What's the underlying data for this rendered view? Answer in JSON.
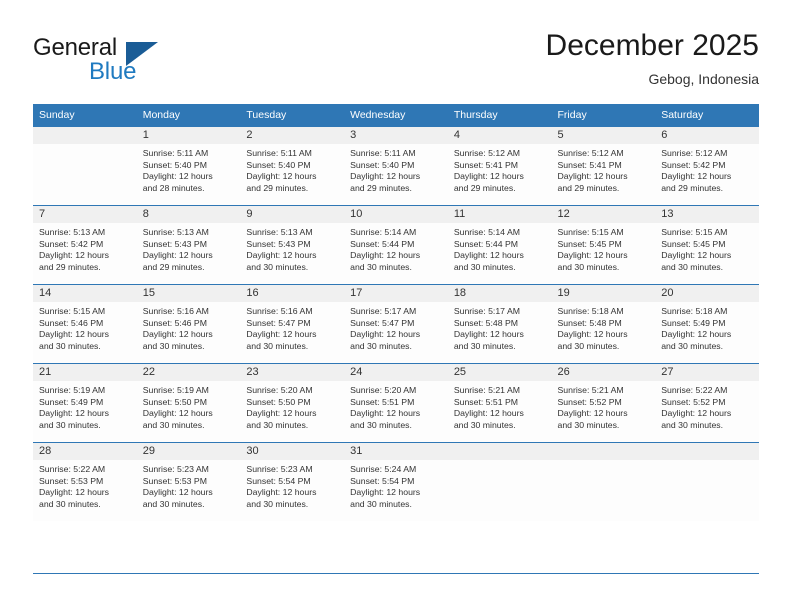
{
  "brand": {
    "name_part1": "General",
    "name_part2": "Blue",
    "triangle_color": "#1a5c96",
    "blue_color": "#1f7ac0"
  },
  "header": {
    "month_title": "December 2025",
    "location": "Gebog, Indonesia"
  },
  "theme": {
    "header_bg": "#2f77b5",
    "daynum_bg": "#f0f0f0",
    "cell_bg": "#fdfdfd",
    "text": "#333333"
  },
  "weekday_headers": [
    "Sunday",
    "Monday",
    "Tuesday",
    "Wednesday",
    "Thursday",
    "Friday",
    "Saturday"
  ],
  "weeks": [
    [
      {
        "day": "",
        "blank": true,
        "sunrise": "",
        "sunset": "",
        "daylight_line1": "",
        "daylight_line2": ""
      },
      {
        "day": "1",
        "sunrise": "Sunrise: 5:11 AM",
        "sunset": "Sunset: 5:40 PM",
        "daylight_line1": "Daylight: 12 hours",
        "daylight_line2": "and 28 minutes."
      },
      {
        "day": "2",
        "sunrise": "Sunrise: 5:11 AM",
        "sunset": "Sunset: 5:40 PM",
        "daylight_line1": "Daylight: 12 hours",
        "daylight_line2": "and 29 minutes."
      },
      {
        "day": "3",
        "sunrise": "Sunrise: 5:11 AM",
        "sunset": "Sunset: 5:40 PM",
        "daylight_line1": "Daylight: 12 hours",
        "daylight_line2": "and 29 minutes."
      },
      {
        "day": "4",
        "sunrise": "Sunrise: 5:12 AM",
        "sunset": "Sunset: 5:41 PM",
        "daylight_line1": "Daylight: 12 hours",
        "daylight_line2": "and 29 minutes."
      },
      {
        "day": "5",
        "sunrise": "Sunrise: 5:12 AM",
        "sunset": "Sunset: 5:41 PM",
        "daylight_line1": "Daylight: 12 hours",
        "daylight_line2": "and 29 minutes."
      },
      {
        "day": "6",
        "sunrise": "Sunrise: 5:12 AM",
        "sunset": "Sunset: 5:42 PM",
        "daylight_line1": "Daylight: 12 hours",
        "daylight_line2": "and 29 minutes."
      }
    ],
    [
      {
        "day": "7",
        "sunrise": "Sunrise: 5:13 AM",
        "sunset": "Sunset: 5:42 PM",
        "daylight_line1": "Daylight: 12 hours",
        "daylight_line2": "and 29 minutes."
      },
      {
        "day": "8",
        "sunrise": "Sunrise: 5:13 AM",
        "sunset": "Sunset: 5:43 PM",
        "daylight_line1": "Daylight: 12 hours",
        "daylight_line2": "and 29 minutes."
      },
      {
        "day": "9",
        "sunrise": "Sunrise: 5:13 AM",
        "sunset": "Sunset: 5:43 PM",
        "daylight_line1": "Daylight: 12 hours",
        "daylight_line2": "and 30 minutes."
      },
      {
        "day": "10",
        "sunrise": "Sunrise: 5:14 AM",
        "sunset": "Sunset: 5:44 PM",
        "daylight_line1": "Daylight: 12 hours",
        "daylight_line2": "and 30 minutes."
      },
      {
        "day": "11",
        "sunrise": "Sunrise: 5:14 AM",
        "sunset": "Sunset: 5:44 PM",
        "daylight_line1": "Daylight: 12 hours",
        "daylight_line2": "and 30 minutes."
      },
      {
        "day": "12",
        "sunrise": "Sunrise: 5:15 AM",
        "sunset": "Sunset: 5:45 PM",
        "daylight_line1": "Daylight: 12 hours",
        "daylight_line2": "and 30 minutes."
      },
      {
        "day": "13",
        "sunrise": "Sunrise: 5:15 AM",
        "sunset": "Sunset: 5:45 PM",
        "daylight_line1": "Daylight: 12 hours",
        "daylight_line2": "and 30 minutes."
      }
    ],
    [
      {
        "day": "14",
        "sunrise": "Sunrise: 5:15 AM",
        "sunset": "Sunset: 5:46 PM",
        "daylight_line1": "Daylight: 12 hours",
        "daylight_line2": "and 30 minutes."
      },
      {
        "day": "15",
        "sunrise": "Sunrise: 5:16 AM",
        "sunset": "Sunset: 5:46 PM",
        "daylight_line1": "Daylight: 12 hours",
        "daylight_line2": "and 30 minutes."
      },
      {
        "day": "16",
        "sunrise": "Sunrise: 5:16 AM",
        "sunset": "Sunset: 5:47 PM",
        "daylight_line1": "Daylight: 12 hours",
        "daylight_line2": "and 30 minutes."
      },
      {
        "day": "17",
        "sunrise": "Sunrise: 5:17 AM",
        "sunset": "Sunset: 5:47 PM",
        "daylight_line1": "Daylight: 12 hours",
        "daylight_line2": "and 30 minutes."
      },
      {
        "day": "18",
        "sunrise": "Sunrise: 5:17 AM",
        "sunset": "Sunset: 5:48 PM",
        "daylight_line1": "Daylight: 12 hours",
        "daylight_line2": "and 30 minutes."
      },
      {
        "day": "19",
        "sunrise": "Sunrise: 5:18 AM",
        "sunset": "Sunset: 5:48 PM",
        "daylight_line1": "Daylight: 12 hours",
        "daylight_line2": "and 30 minutes."
      },
      {
        "day": "20",
        "sunrise": "Sunrise: 5:18 AM",
        "sunset": "Sunset: 5:49 PM",
        "daylight_line1": "Daylight: 12 hours",
        "daylight_line2": "and 30 minutes."
      }
    ],
    [
      {
        "day": "21",
        "sunrise": "Sunrise: 5:19 AM",
        "sunset": "Sunset: 5:49 PM",
        "daylight_line1": "Daylight: 12 hours",
        "daylight_line2": "and 30 minutes."
      },
      {
        "day": "22",
        "sunrise": "Sunrise: 5:19 AM",
        "sunset": "Sunset: 5:50 PM",
        "daylight_line1": "Daylight: 12 hours",
        "daylight_line2": "and 30 minutes."
      },
      {
        "day": "23",
        "sunrise": "Sunrise: 5:20 AM",
        "sunset": "Sunset: 5:50 PM",
        "daylight_line1": "Daylight: 12 hours",
        "daylight_line2": "and 30 minutes."
      },
      {
        "day": "24",
        "sunrise": "Sunrise: 5:20 AM",
        "sunset": "Sunset: 5:51 PM",
        "daylight_line1": "Daylight: 12 hours",
        "daylight_line2": "and 30 minutes."
      },
      {
        "day": "25",
        "sunrise": "Sunrise: 5:21 AM",
        "sunset": "Sunset: 5:51 PM",
        "daylight_line1": "Daylight: 12 hours",
        "daylight_line2": "and 30 minutes."
      },
      {
        "day": "26",
        "sunrise": "Sunrise: 5:21 AM",
        "sunset": "Sunset: 5:52 PM",
        "daylight_line1": "Daylight: 12 hours",
        "daylight_line2": "and 30 minutes."
      },
      {
        "day": "27",
        "sunrise": "Sunrise: 5:22 AM",
        "sunset": "Sunset: 5:52 PM",
        "daylight_line1": "Daylight: 12 hours",
        "daylight_line2": "and 30 minutes."
      }
    ],
    [
      {
        "day": "28",
        "sunrise": "Sunrise: 5:22 AM",
        "sunset": "Sunset: 5:53 PM",
        "daylight_line1": "Daylight: 12 hours",
        "daylight_line2": "and 30 minutes."
      },
      {
        "day": "29",
        "sunrise": "Sunrise: 5:23 AM",
        "sunset": "Sunset: 5:53 PM",
        "daylight_line1": "Daylight: 12 hours",
        "daylight_line2": "and 30 minutes."
      },
      {
        "day": "30",
        "sunrise": "Sunrise: 5:23 AM",
        "sunset": "Sunset: 5:54 PM",
        "daylight_line1": "Daylight: 12 hours",
        "daylight_line2": "and 30 minutes."
      },
      {
        "day": "31",
        "sunrise": "Sunrise: 5:24 AM",
        "sunset": "Sunset: 5:54 PM",
        "daylight_line1": "Daylight: 12 hours",
        "daylight_line2": "and 30 minutes."
      },
      {
        "day": "",
        "blank": true,
        "sunrise": "",
        "sunset": "",
        "daylight_line1": "",
        "daylight_line2": ""
      },
      {
        "day": "",
        "blank": true,
        "sunrise": "",
        "sunset": "",
        "daylight_line1": "",
        "daylight_line2": ""
      },
      {
        "day": "",
        "blank": true,
        "sunrise": "",
        "sunset": "",
        "daylight_line1": "",
        "daylight_line2": ""
      }
    ]
  ]
}
